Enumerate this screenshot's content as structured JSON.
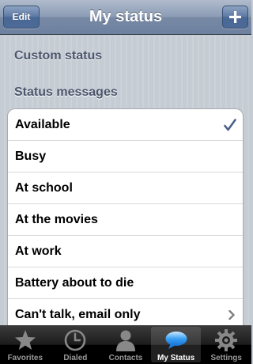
{
  "navbar": {
    "title": "My status",
    "edit_label": "Edit"
  },
  "sections": {
    "custom_status": "Custom status",
    "status_messages": "Status messages"
  },
  "status_messages": [
    {
      "label": "Available",
      "selected": true
    },
    {
      "label": "Busy"
    },
    {
      "label": "At school"
    },
    {
      "label": "At the movies"
    },
    {
      "label": "At work"
    },
    {
      "label": "Battery about to die"
    },
    {
      "label": "Can't talk, email only",
      "accessory": "chevron"
    }
  ],
  "tabbar": {
    "items": [
      {
        "label": "Favorites",
        "icon": "star-icon"
      },
      {
        "label": "Dialed",
        "icon": "clock-icon"
      },
      {
        "label": "Contacts",
        "icon": "person-icon"
      },
      {
        "label": "My Status",
        "icon": "speech-bubble-icon",
        "active": true
      },
      {
        "label": "Settings",
        "icon": "gear-icon"
      }
    ]
  },
  "colors": {
    "checkmark": "#4b5f8c",
    "navbar": "#6d81a0",
    "section_header": "#4c566c"
  }
}
